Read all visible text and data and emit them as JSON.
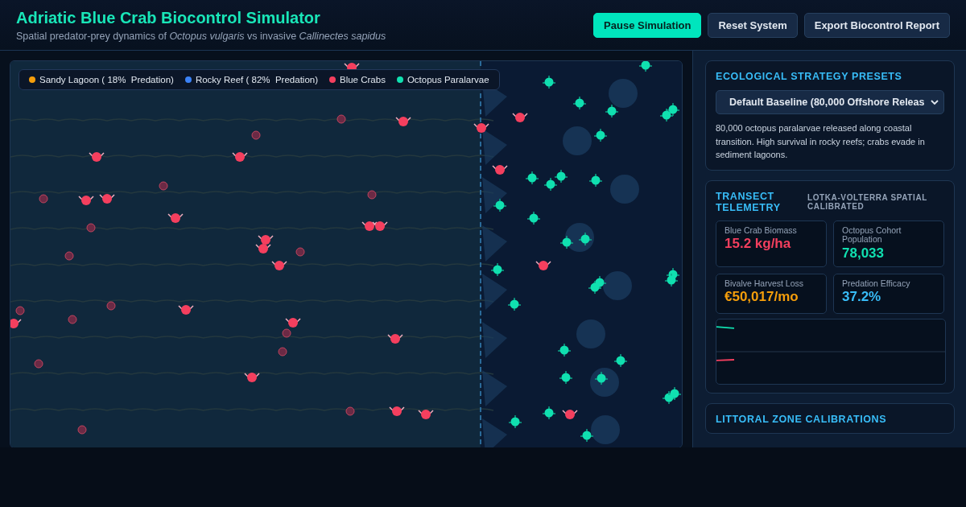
{
  "header": {
    "title": "Adriatic Blue Crab Biocontrol Simulator",
    "subtitle": "Spatial predator-prey dynamics of *Octopus vulgaris* vs invasive *Callinectes sapidus*",
    "buttons": [
      {
        "label": "Pause Simulation",
        "kind": "primary"
      },
      {
        "label": "Reset System",
        "kind": "secondary"
      },
      {
        "label": "Export Biocontrol Report",
        "kind": "secondary"
      }
    ]
  },
  "legend": [
    {
      "label": "Sandy Lagoon ( 18%  Predation)",
      "color": "#f59e0b"
    },
    {
      "label": "Rocky Reef ( 82%  Predation)",
      "color": "#3b82f6"
    },
    {
      "label": "Blue Crabs",
      "color": "#f43f5e"
    },
    {
      "label": "Octopus Paralarvae",
      "color": "#10e0b0"
    }
  ],
  "presets": {
    "title": "ECOLOGICAL STRATEGY PRESETS",
    "selected_option": "Default Baseline (80,000 Offshore Releas",
    "description": "80,000 octopus paralarvae released along coastal transition. High survival in rocky reefs; crabs evade in sediment lagoons."
  },
  "telemetry": {
    "title": "TRANSECT TELEMETRY",
    "badge": "LOTKA-VOLTERRA SPATIAL CALIBRATED",
    "metrics": [
      {
        "label": "Blue Crab Biomass",
        "value": "15.2 kg/ha",
        "color": "#f43f5e"
      },
      {
        "label": "Octopus Cohort Population",
        "value": "78,033",
        "color": "#10e0b0"
      },
      {
        "label": "Bivalve Harvest Loss",
        "value": "€50,017/mo",
        "color": "#f59e0b"
      },
      {
        "label": "Predation Efficacy",
        "value": "37.2%",
        "color": "#38bdf8"
      }
    ]
  },
  "calibrations": {
    "title": "LITTORAL ZONE CALIBRATIONS"
  }
}
